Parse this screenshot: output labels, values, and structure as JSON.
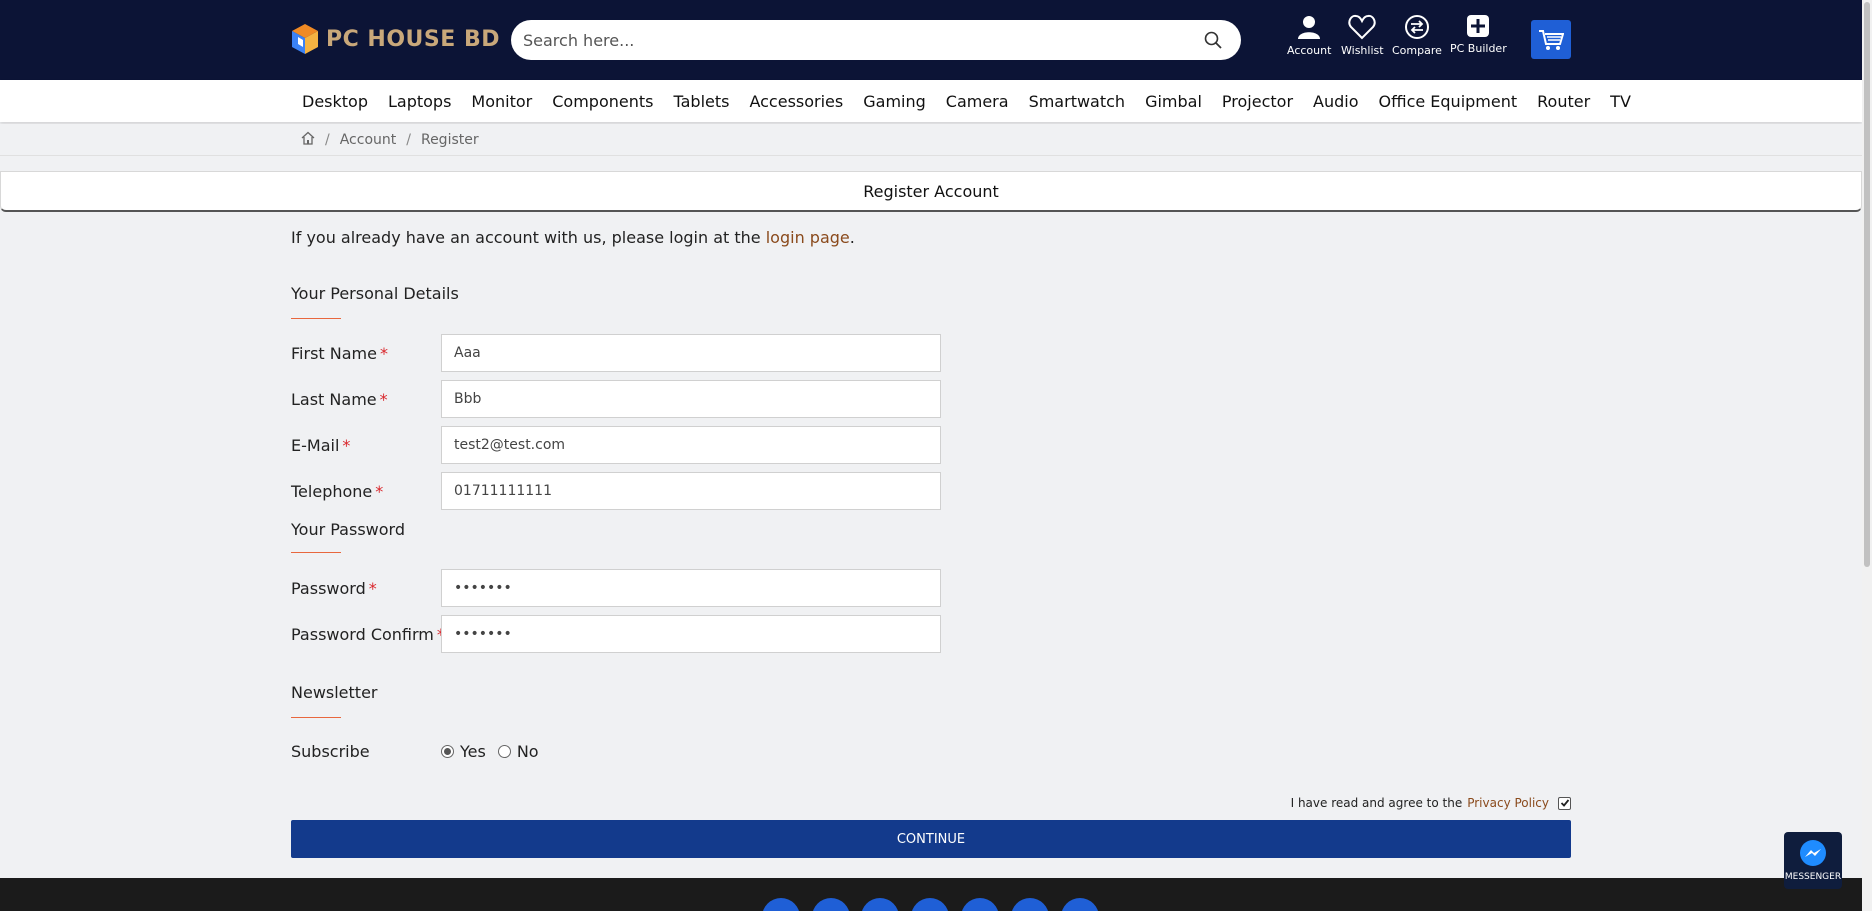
{
  "header": {
    "logo_text": "PC HOUSE BD",
    "search_placeholder": "Search here...",
    "icons": [
      {
        "name": "account-icon",
        "label": "Account"
      },
      {
        "name": "heart-icon",
        "label": "Wishlist"
      },
      {
        "name": "compare-icon",
        "label": "Compare"
      },
      {
        "name": "plus-icon",
        "label": "PC Builder"
      }
    ],
    "cart_icon": "cart-icon"
  },
  "nav": {
    "items": [
      "Desktop",
      "Laptops",
      "Monitor",
      "Components",
      "Tablets",
      "Accessories",
      "Gaming",
      "Camera",
      "Smartwatch",
      "Gimbal",
      "Projector",
      "Audio",
      "Office Equipment",
      "Router",
      "TV"
    ]
  },
  "breadcrumb": {
    "home_icon": "home-icon",
    "sep": "/",
    "items": [
      "Account",
      "Register"
    ]
  },
  "page": {
    "title": "Register Account",
    "intro_before": "If you already have an account with us, please login at the ",
    "intro_link": "login page",
    "intro_after": "."
  },
  "personal": {
    "title": "Your Personal Details",
    "required_mark": "*",
    "fields": {
      "first_name": {
        "label": "First Name",
        "value": "Aaa"
      },
      "last_name": {
        "label": "Last Name",
        "value": "Bbb"
      },
      "email": {
        "label": "E-Mail",
        "value": "test2@test.com"
      },
      "telephone": {
        "label": "Telephone",
        "value": "01711111111"
      }
    }
  },
  "password": {
    "title": "Your Password",
    "fields": {
      "password": {
        "label": "Password",
        "value": "•••••••"
      },
      "confirm": {
        "label": "Password Confirm",
        "value": "•••••••"
      }
    }
  },
  "newsletter": {
    "title": "Newsletter",
    "subscribe_label": "Subscribe",
    "options": [
      "Yes",
      "No"
    ],
    "selected": "Yes"
  },
  "agree": {
    "text": "I have read and agree to the",
    "link": "Privacy Policy",
    "checked": true
  },
  "actions": {
    "continue_label": "CONTINUE"
  },
  "messenger": {
    "label": "MESSENGER"
  },
  "colors": {
    "header_bg": "#0c1436",
    "cart_bg": "#1f5fd6",
    "continue_bg": "#133a8c",
    "link": "#8a4a1c",
    "accent_line": "#e8673d",
    "required": "#d9262b"
  }
}
